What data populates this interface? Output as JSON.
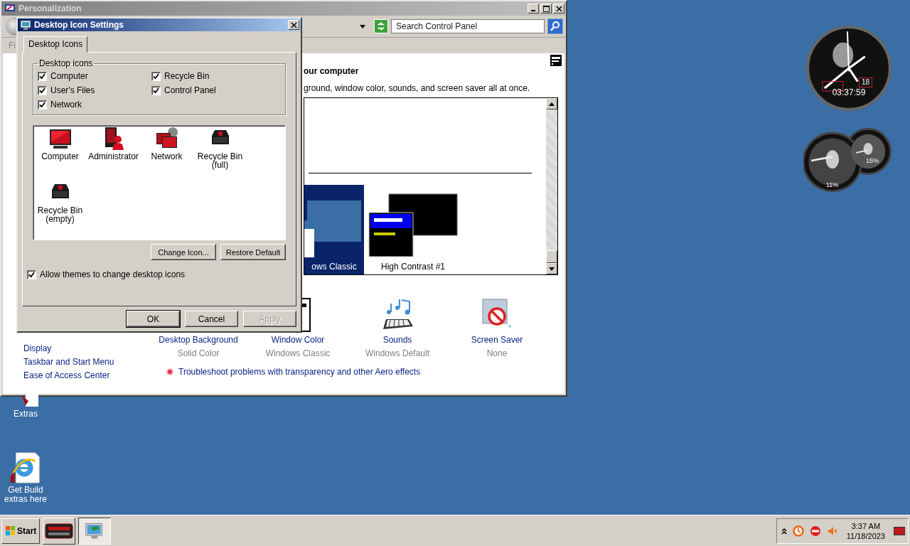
{
  "personalization_window": {
    "title": "Personalization",
    "search": {
      "placeholder": "Search Control Panel"
    },
    "menu_fragment": "Fi",
    "heading": "our computer",
    "description": "ground, window color, sounds, and screen saver all at once.",
    "themes": [
      {
        "label": "ows Classic",
        "kind": "classic",
        "selected": true
      },
      {
        "label": "High Contrast #1",
        "kind": "contrast",
        "selected": false
      }
    ],
    "settings": [
      {
        "label": "Desktop Background",
        "value": "Solid Color",
        "kind": "background"
      },
      {
        "label": "Window Color",
        "value": "Windows Classic",
        "kind": "window"
      },
      {
        "label": "Sounds",
        "value": "Windows Default",
        "kind": "sounds"
      },
      {
        "label": "Screen Saver",
        "value": "None",
        "kind": "screensaver"
      }
    ],
    "see_also": [
      "Display",
      "Taskbar and Start Menu",
      "Ease of Access Center"
    ],
    "troubleshoot_link": "Troubleshoot problems with transparency and other Aero effects"
  },
  "dialog": {
    "title": "Desktop Icon Settings",
    "tabs": [
      {
        "label": "Desktop Icons",
        "selected": true
      }
    ],
    "group_title": "Desktop icons",
    "checkboxes": [
      {
        "label": "Computer",
        "checked": true
      },
      {
        "label": "Recycle Bin",
        "checked": true
      },
      {
        "label": "User's Files",
        "checked": true
      },
      {
        "label": "Control Panel",
        "checked": true
      },
      {
        "label": "Network",
        "checked": true
      }
    ],
    "icons": [
      {
        "label": "Computer",
        "kind": "monitor"
      },
      {
        "label": "Administrator",
        "kind": "user"
      },
      {
        "label": "Network",
        "kind": "network"
      },
      {
        "label": "Recycle Bin\n(full)",
        "kind": "bin"
      },
      {
        "label": "Recycle Bin\n(empty)",
        "kind": "bin"
      }
    ],
    "change_icon_button": "Change Icon...",
    "restore_button": "Restore Default",
    "allow_themes": {
      "label": "Allow themes to change desktop icons",
      "checked": true
    },
    "buttons": [
      {
        "label": "OK",
        "disabled": false,
        "default": true
      },
      {
        "label": "Cancel",
        "disabled": false,
        "default": false
      },
      {
        "label": "Apply",
        "disabled": true,
        "default": false
      }
    ]
  },
  "desktop_icons": [
    {
      "label": "Extras",
      "kind": "extras"
    },
    {
      "label": "Get Build\nextras here",
      "kind": "browser"
    }
  ],
  "gadgets": {
    "clock": {
      "date": "18",
      "time": "03:37:59"
    },
    "meter": {
      "readings": [
        "11%",
        "15%"
      ]
    }
  },
  "taskbar": {
    "start": "Start",
    "tasks": [
      {
        "kind": "gadgets",
        "selected": false
      },
      {
        "kind": "display",
        "selected": true
      }
    ],
    "time": "3:37 AM",
    "date": "11/18/2023"
  }
}
